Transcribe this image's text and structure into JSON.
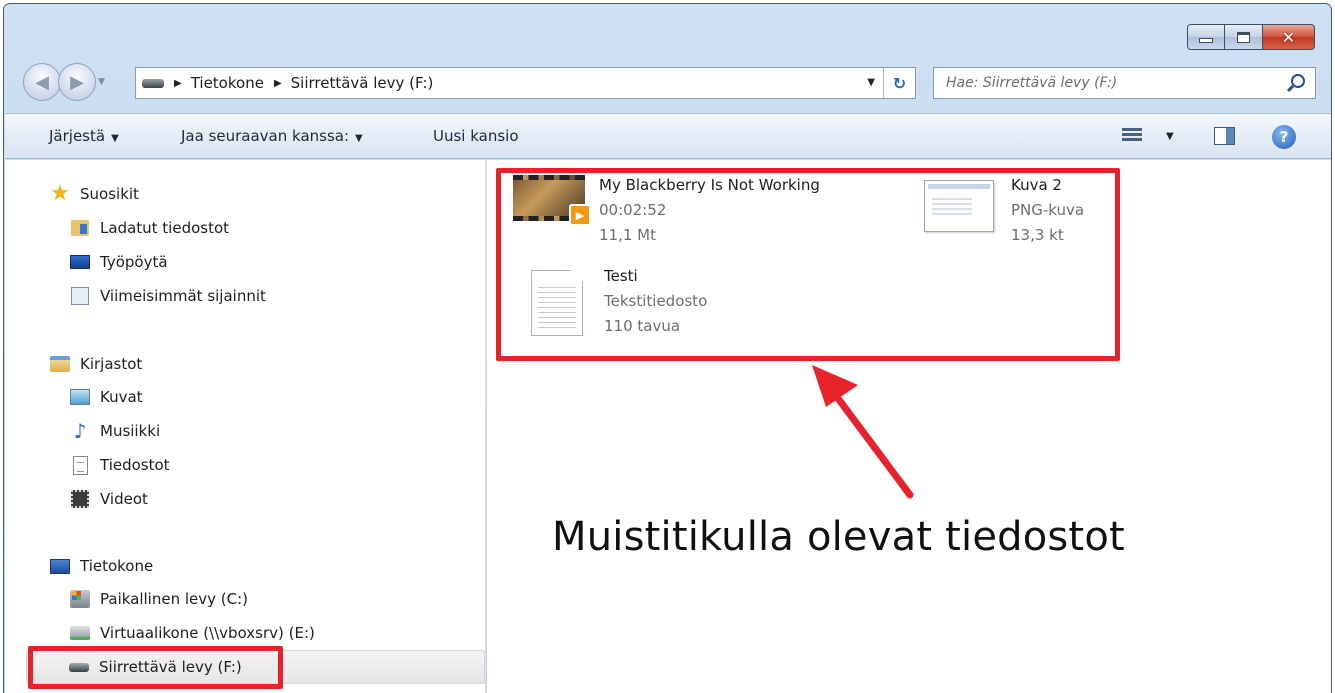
{
  "window": {
    "caption_buttons": {
      "minimize_icon": "minimize-icon",
      "maximize_icon": "maximize-icon",
      "close_glyph": "✕"
    }
  },
  "navigation": {
    "address_parts": [
      "Tietokone",
      "Siirrettävä levy (F:)"
    ],
    "search_placeholder": "Hae: Siirrettävä levy (F:)"
  },
  "toolbar": {
    "organize_label": "Järjestä",
    "share_label": "Jaa seuraavan kanssa:",
    "new_folder_label": "Uusi kansio"
  },
  "sidebar": {
    "favorites": {
      "header": "Suosikit",
      "items": [
        "Ladatut tiedostot",
        "Työpöytä",
        "Viimeisimmät sijainnit"
      ]
    },
    "libraries": {
      "header": "Kirjastot",
      "items": [
        "Kuvat",
        "Musiikki",
        "Tiedostot",
        "Videot"
      ]
    },
    "computer": {
      "header": "Tietokone",
      "items": [
        "Paikallinen levy (C:)",
        "Virtuaalikone (\\\\vboxsrv) (E:)",
        "Siirrettävä levy (F:)"
      ],
      "selected": "Siirrettävä levy (F:)"
    }
  },
  "files": [
    {
      "name": "My Blackberry Is Not Working",
      "line2": "00:02:52",
      "line3": "11,1 Mt",
      "kind": "video"
    },
    {
      "name": "Kuva 2",
      "line2": "PNG-kuva",
      "line3": "13,3 kt",
      "kind": "image"
    },
    {
      "name": "Testi",
      "line2": "Tekstitiedosto",
      "line3": "110 tavua",
      "kind": "text"
    }
  ],
  "annotation": {
    "text": "Muistitikulla olevat tiedostot",
    "highlight_color": "#e8222a"
  }
}
